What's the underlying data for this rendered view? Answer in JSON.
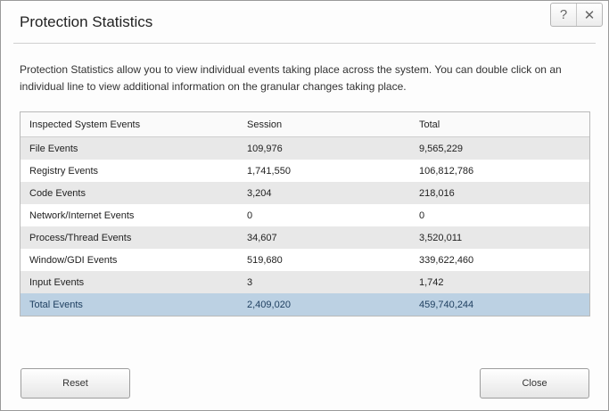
{
  "dialog": {
    "title": "Protection Statistics",
    "description": "Protection Statistics allow you to view individual events taking place across the system. You can double click on an individual line to view additional information on the granular changes taking place.",
    "help_glyph": "?",
    "close_glyph": "✕"
  },
  "table": {
    "headers": [
      "Inspected System Events",
      "Session",
      "Total"
    ],
    "rows": [
      {
        "name": "File Events",
        "session": "109,976",
        "total": "9,565,229"
      },
      {
        "name": "Registry Events",
        "session": "1,741,550",
        "total": "106,812,786"
      },
      {
        "name": "Code Events",
        "session": "3,204",
        "total": "218,016"
      },
      {
        "name": "Network/Internet Events",
        "session": "0",
        "total": "0"
      },
      {
        "name": "Process/Thread Events",
        "session": "34,607",
        "total": "3,520,011"
      },
      {
        "name": "Window/GDI Events",
        "session": "519,680",
        "total": "339,622,460"
      },
      {
        "name": "Input Events",
        "session": "3",
        "total": "1,742"
      },
      {
        "name": "Total Events",
        "session": "2,409,020",
        "total": "459,740,244"
      }
    ]
  },
  "buttons": {
    "reset": "Reset",
    "close": "Close"
  },
  "colors": {
    "selected_row": "#bcd1e3",
    "alt_row": "#e8e8e8"
  }
}
